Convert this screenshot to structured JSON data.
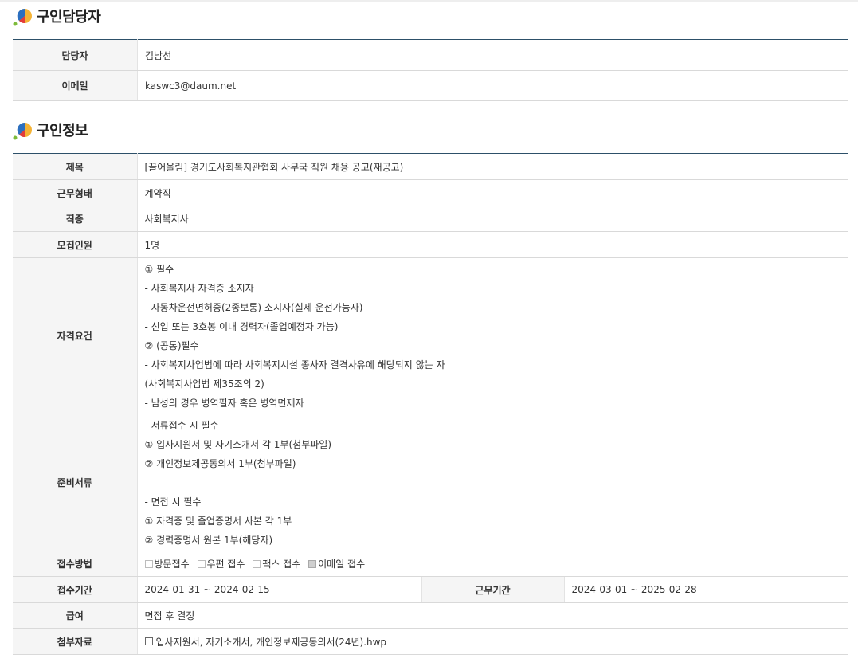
{
  "contact_section": {
    "title": "구인담당자",
    "rows": [
      {
        "label": "담당자",
        "value": "김남선"
      },
      {
        "label": "이메일",
        "value": "kaswc3@daum.net"
      }
    ]
  },
  "job_section": {
    "title": "구인정보",
    "title_row": {
      "label": "제목",
      "value": "[끌어올림] 경기도사회복지관협회 사무국 직원 채용 공고(재공고)"
    },
    "employment_type": {
      "label": "근무형태",
      "value": "계약직"
    },
    "job_category": {
      "label": "직종",
      "value": "사회복지사"
    },
    "openings": {
      "label": "모집인원",
      "value": "1명"
    },
    "qualifications": {
      "label": "자격요건",
      "lines": [
        "① 필수",
        "- 사회복지사 자격증 소지자",
        "- 자동차운전면허증(2종보통) 소지자(실제 운전가능자)",
        "- 신입 또는 3호봉 이내 경력자(졸업예정자 가능)",
        "② (공통)필수",
        "- 사회복지사업법에 따라 사회복지시설 종사자 결격사유에 해당되지 않는 자",
        "(사회복지사업법 제35조의 2)",
        "- 남성의 경우 병역필자 혹은 병역면제자"
      ]
    },
    "documents": {
      "label": "준비서류",
      "lines": [
        "- 서류접수 시 필수",
        "① 입사지원서 및 자기소개서 각 1부(첨부파일)",
        "② 개인정보제공동의서 1부(첨부파일)",
        "",
        "- 면접 시 필수",
        "① 자격증 및 졸업증명서 사본 각 1부",
        "② 경력증명서 원본 1부(해당자)"
      ]
    },
    "application_method": {
      "label": "접수방법",
      "options": [
        {
          "label": "방문접수",
          "checked": false
        },
        {
          "label": "우편 접수",
          "checked": false
        },
        {
          "label": "팩스 접수",
          "checked": false
        },
        {
          "label": "이메일 접수",
          "checked": true
        }
      ]
    },
    "period": {
      "label": "접수기간",
      "value": "2024-01-31 ~ 2024-02-15",
      "work_label": "근무기간",
      "work_value": "2024-03-01 ~ 2025-02-28"
    },
    "salary": {
      "label": "급여",
      "value": "면접 후 결정"
    },
    "attachment": {
      "label": "첨부자료",
      "icon": "file-icon",
      "file": "입사지원서, 자기소개서, 개인정보제공동의서(24년).hwp"
    }
  }
}
